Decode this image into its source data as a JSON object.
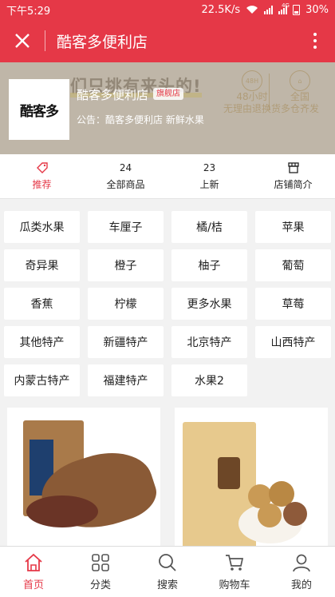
{
  "status_bar": {
    "time": "下午5:29",
    "net_speed": "22.5K/s",
    "network_type": "4G",
    "battery": "30%"
  },
  "nav": {
    "title": "酷客多便利店"
  },
  "banner": {
    "slogan": "们只挑有来头的!",
    "promo_48h_badge": "48H",
    "promo_48h": "48小时\n无理由退换货",
    "promo_multi": "全国\n多仓齐发"
  },
  "store": {
    "logo_text": "酷客多",
    "name": "酷客多便利店",
    "badge": "旗舰店",
    "notice": "公告：酷客多便利店 新鲜水果"
  },
  "tabs": {
    "recommend": "推荐",
    "all_count": "24",
    "all_label": "全部商品",
    "new_count": "23",
    "new_label": "上新",
    "intro_label": "店铺简介"
  },
  "categories": [
    "瓜类水果",
    "车厘子",
    "橘/桔",
    "苹果",
    "奇异果",
    "橙子",
    "柚子",
    "葡萄",
    "香蕉",
    "柠檬",
    "更多水果",
    "草莓",
    "其他特产",
    "新疆特产",
    "北京特产",
    "山西特产",
    "内蒙古特产",
    "福建特产",
    "水果2"
  ],
  "bottom_nav": {
    "home": "首页",
    "category": "分类",
    "search": "搜索",
    "cart": "购物车",
    "mine": "我的"
  },
  "colors": {
    "accent": "#e53847",
    "background": "#f2f2f2"
  }
}
